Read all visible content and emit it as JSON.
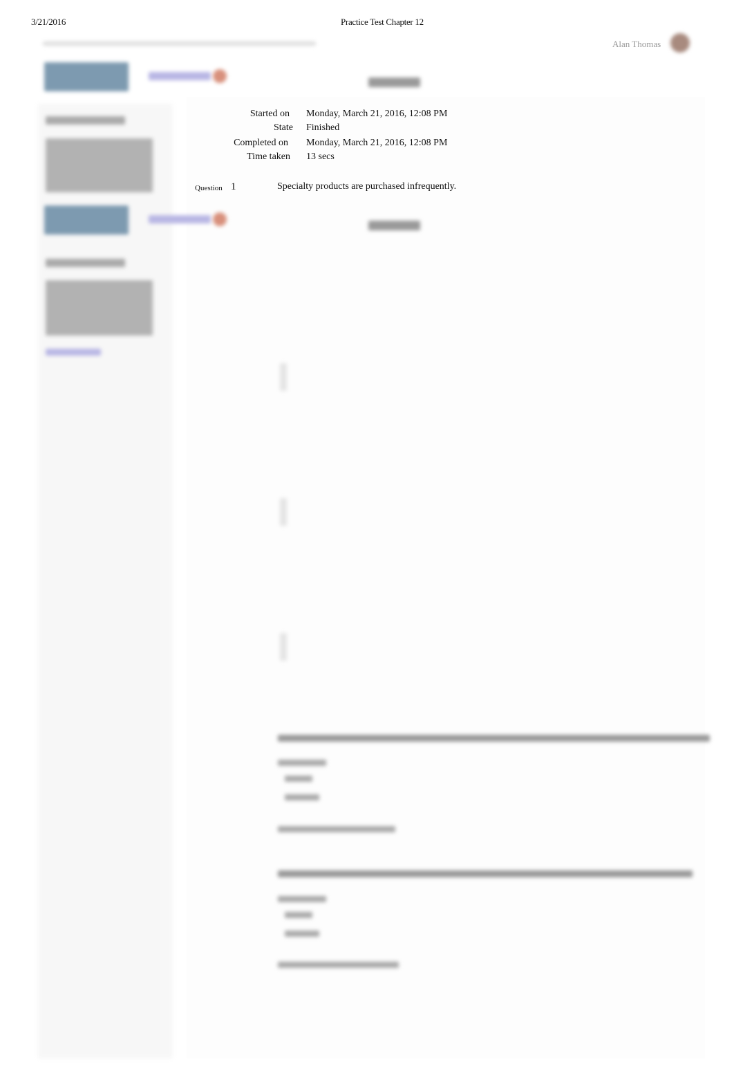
{
  "print_header": {
    "date": "3/21/2016",
    "title": "Practice Test Chapter 12"
  },
  "user": {
    "name": "Alan Thomas"
  },
  "summary": [
    {
      "label": "Started on",
      "value": "Monday, March 21, 2016, 12:08 PM"
    },
    {
      "label": "State",
      "value": "Finished"
    },
    {
      "label": "Completed on",
      "value": "Monday, March 21, 2016, 12:08 PM"
    },
    {
      "label": "Time taken",
      "value": "13 secs"
    }
  ],
  "question": {
    "label": "Question",
    "number": "1",
    "text": "Specialty products are purchased infrequently."
  },
  "colors": {
    "logo": "#6f8fa8",
    "link": "#6a6fd0",
    "badge": "#c9705a"
  }
}
